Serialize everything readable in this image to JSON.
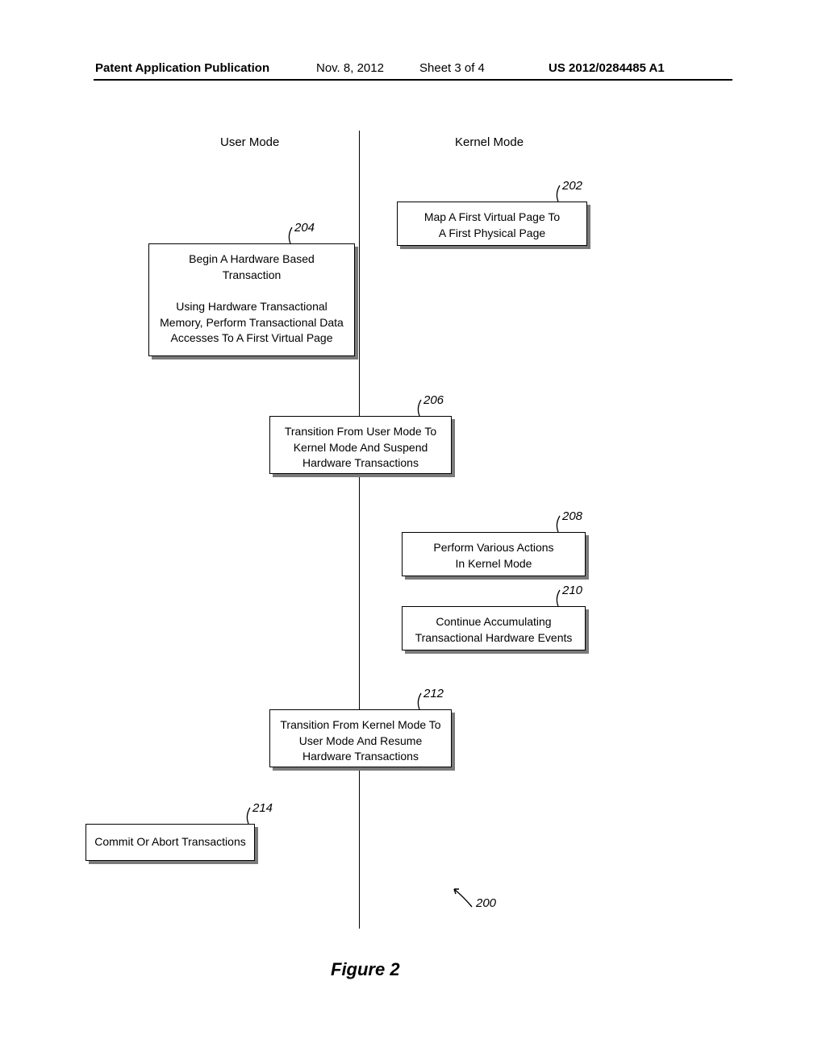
{
  "header": {
    "left": "Patent Application Publication",
    "date": "Nov. 8, 2012",
    "sheet": "Sheet 3 of 4",
    "right": "US 2012/0284485 A1"
  },
  "columns": {
    "user": "User Mode",
    "kernel": "Kernel Mode"
  },
  "boxes": {
    "b202": {
      "ref": "202",
      "line1": "Map A First Virtual Page To",
      "line2": "A First Physical Page"
    },
    "b204": {
      "ref": "204",
      "line1": "Begin A Hardware Based",
      "line2": "Transaction",
      "line3": "Using Hardware Transactional",
      "line4": "Memory, Perform Transactional Data",
      "line5": "Accesses To A First Virtual Page"
    },
    "b206": {
      "ref": "206",
      "line1": "Transition From User Mode To",
      "line2": "Kernel Mode And Suspend",
      "line3": "Hardware Transactions"
    },
    "b208": {
      "ref": "208",
      "line1": "Perform Various Actions",
      "line2": "In Kernel Mode"
    },
    "b210": {
      "ref": "210",
      "line1": "Continue Accumulating",
      "line2": "Transactional Hardware Events"
    },
    "b212": {
      "ref": "212",
      "line1": "Transition From Kernel Mode To",
      "line2": "User Mode And Resume",
      "line3": "Hardware Transactions"
    },
    "b214": {
      "ref": "214",
      "line1": "Commit Or Abort Transactions"
    }
  },
  "figure_ref": "200",
  "figure_caption": "Figure 2"
}
